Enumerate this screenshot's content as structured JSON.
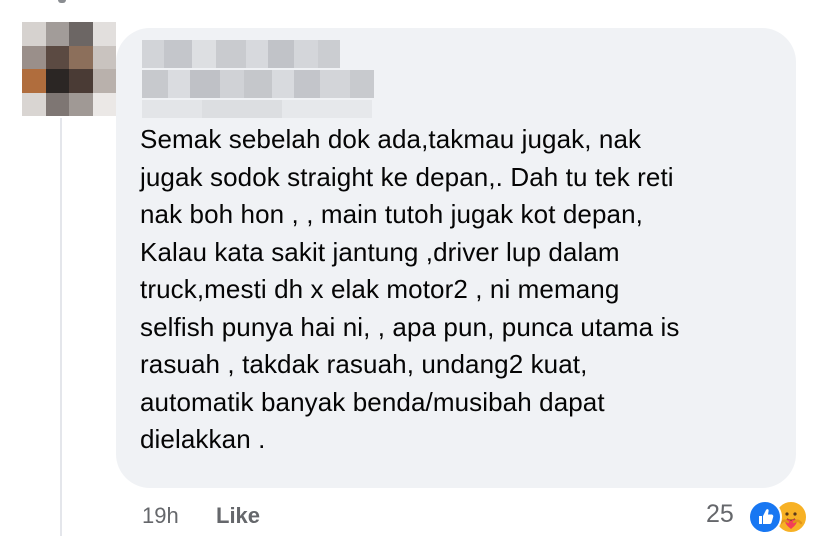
{
  "comment": {
    "text": "Semak sebelah dok ada,takmau jugak, nak\njugak sodok straight ke depan,. Dah tu tek reti\nnak boh hon , , main tutoh jugak kot depan,\nKalau kata sakit jantung ,driver lup dalam\ntruck,mesti dh x elak motor2 , ni memang\nselfish punya hai ni, , apa pun, punca utama is\nrasuah , takdak rasuah, undang2 kuat,\nautomatik banyak benda/musibah dapat\ndielakkan .",
    "author_blurred": true,
    "avatar_blurred": true
  },
  "meta": {
    "time": "19h",
    "like_label": "Like"
  },
  "reactions": {
    "count": "25",
    "icons": [
      "like-icon",
      "care-icon"
    ]
  },
  "colors": {
    "bubble": "#f0f2f5",
    "text": "#050505",
    "meta": "#65676b",
    "like_blue": "#1877f2",
    "care_yellow": "#f7b125"
  }
}
